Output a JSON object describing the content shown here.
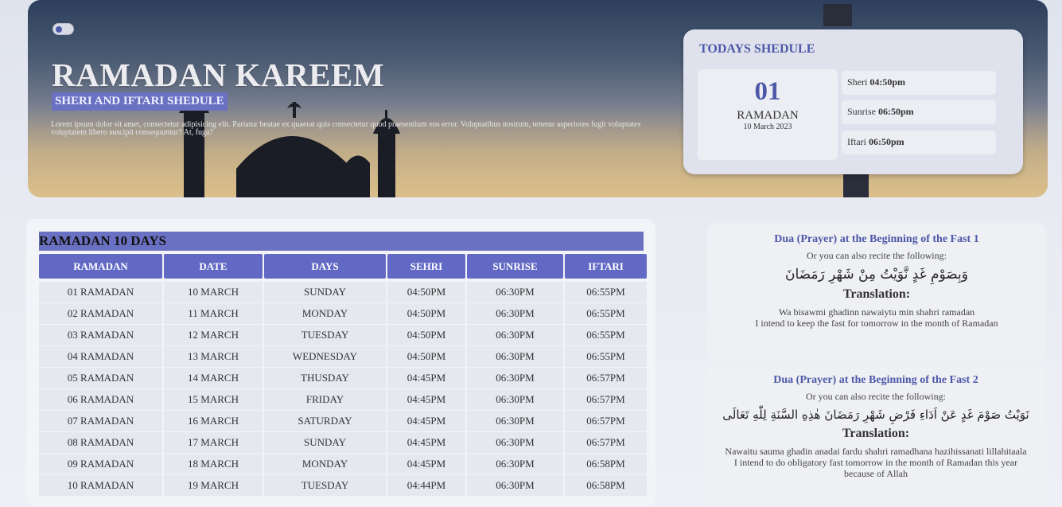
{
  "hero": {
    "title": "RAMADAN KAREEM",
    "subtitle": "SHERI AND IFTARI SHEDULE",
    "description": "Lorem ipsum dolor sit amet, consectetur adipisicing elit. Pariatur beatae ex quaerat quis consectetur quod praesentium eos error. Voluptatibus nostrum, tenetur asperiores fugit voluptates voluptatem libero suscipit consequuntur? At, fuga?"
  },
  "today": {
    "title": "TODAYS SHEDULE",
    "day_number": "01",
    "month": "RAMADAN",
    "date": "10 March 2023",
    "sheri_label": "Sheri",
    "sheri_time": "04:50pm",
    "sunrise_label": "Sunrise",
    "sunrise_time": "06:50pm",
    "iftari_label": "Iftari",
    "iftari_time": "06:50pm"
  },
  "schedule": {
    "caption": "RAMADAN 10 DAYS",
    "headers": [
      "RAMADAN",
      "DATE",
      "DAYS",
      "SEHRI",
      "SUNRISE",
      "IFTARI"
    ],
    "rows": [
      [
        "01 RAMADAN",
        "10 MARCH",
        "SUNDAY",
        "04:50PM",
        "06:30PM",
        "06:55PM"
      ],
      [
        "02 RAMADAN",
        "11 MARCH",
        "MONDAY",
        "04:50PM",
        "06:30PM",
        "06:55PM"
      ],
      [
        "03 RAMADAN",
        "12 MARCH",
        "TUESDAY",
        "04:50PM",
        "06:30PM",
        "06:55PM"
      ],
      [
        "04 RAMADAN",
        "13 MARCH",
        "WEDNESDAY",
        "04:50PM",
        "06:30PM",
        "06:55PM"
      ],
      [
        "05 RAMADAN",
        "14 MARCH",
        "THUSDAY",
        "04:45PM",
        "06:30PM",
        "06:57PM"
      ],
      [
        "06 RAMADAN",
        "15 MARCH",
        "FRIDAY",
        "04:45PM",
        "06:30PM",
        "06:57PM"
      ],
      [
        "07 RAMADAN",
        "16 MARCH",
        "SATURDAY",
        "04:45PM",
        "06:30PM",
        "06:57PM"
      ],
      [
        "08 RAMADAN",
        "17 MARCH",
        "SUNDAY",
        "04:45PM",
        "06:30PM",
        "06:57PM"
      ],
      [
        "09 RAMADAN",
        "18 MARCH",
        "MONDAY",
        "04:45PM",
        "06:30PM",
        "06:58PM"
      ],
      [
        "10 RAMADAN",
        "19 MARCH",
        "TUESDAY",
        "04:44PM",
        "06:30PM",
        "06:58PM"
      ]
    ]
  },
  "duas": [
    {
      "title": "Dua (Prayer) at the Beginning of the Fast 1",
      "hint": "Or you can also recite the following:",
      "arabic": "وَبِصَوْمِ غَدٍ نَّوَيْتُ مِنْ شَهْرِ رَمَضَانَ",
      "translation_title": "Translation:",
      "line1": "Wa bisawmi ghadinn nawaiytu min shahri ramadan",
      "line2": "I intend to keep the fast for tomorrow in the month of Ramadan"
    },
    {
      "title": "Dua (Prayer) at the Beginning of the Fast 2",
      "hint": "Or you can also recite the following:",
      "arabic": "نَوَيْتُ صَوْمَ غَدٍ عَنْ اَدَاءِ فَرْضِ شَهْرِ رَمَضَانَ هٰذِهِ السَّنَةِ لِلّٰهِ تَعَالَى",
      "translation_title": "Translation:",
      "line1": "Nawaitu sauma ghadin anadai fardu shahri ramadhana hazihissanati lillahitaala",
      "line2": "I intend to do obligatory fast tomorrow in the month of Ramadan this year because of Allah"
    }
  ]
}
